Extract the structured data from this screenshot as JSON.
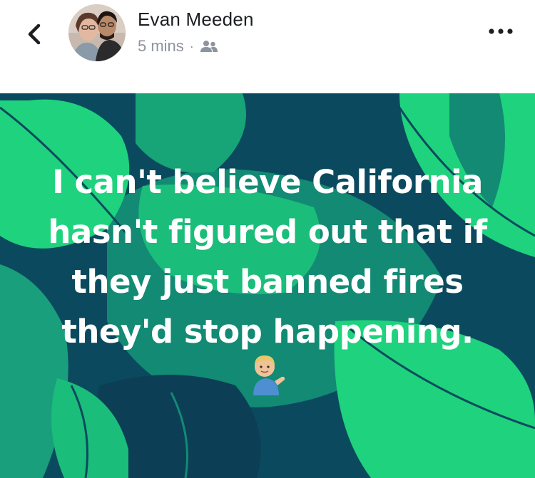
{
  "post": {
    "author_name": "Evan Meeden",
    "timestamp": "5 mins",
    "separator": "·",
    "audience_icon": "friends-icon",
    "body_lines": [
      "I can't believe California",
      "hasn't figured out that if",
      "they just banned fires",
      "they'd stop happening."
    ],
    "emoji": "person-tipping-hand-emoji"
  },
  "header": {
    "back_icon": "chevron-left-icon",
    "more_icon": "more-options-icon"
  },
  "colors": {
    "background_dark": "#0a4a5c",
    "leaf_green": "#1fd27d",
    "leaf_teal": "#138070",
    "meta_gray": "#8d949e"
  }
}
